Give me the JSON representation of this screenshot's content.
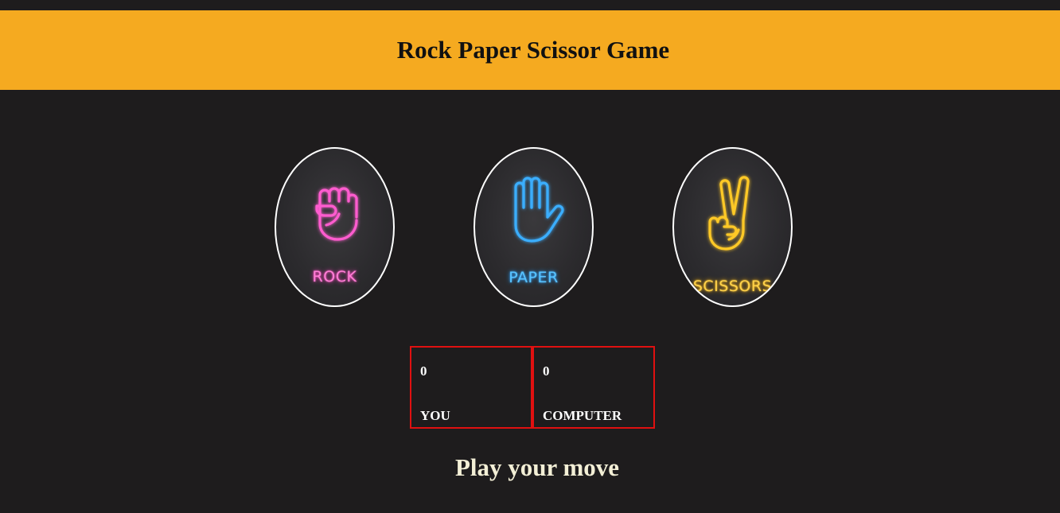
{
  "header": {
    "title": "Rock Paper Scissor Game"
  },
  "choices": [
    {
      "id": "rock",
      "label": "ROCK",
      "color": "#ff5ccf"
    },
    {
      "id": "paper",
      "label": "PAPER",
      "color": "#3aaeff"
    },
    {
      "id": "scissors",
      "label": "SCISSORS",
      "color": "#ffc928"
    }
  ],
  "scores": {
    "user": {
      "value": "0",
      "label": "YOU"
    },
    "computer": {
      "value": "0",
      "label": "COMPUTER"
    }
  },
  "message": "Play your move",
  "colors": {
    "background": "#1e1c1d",
    "header": "#f5aa20",
    "score_border": "#e01010",
    "message": "#f3efd6"
  }
}
